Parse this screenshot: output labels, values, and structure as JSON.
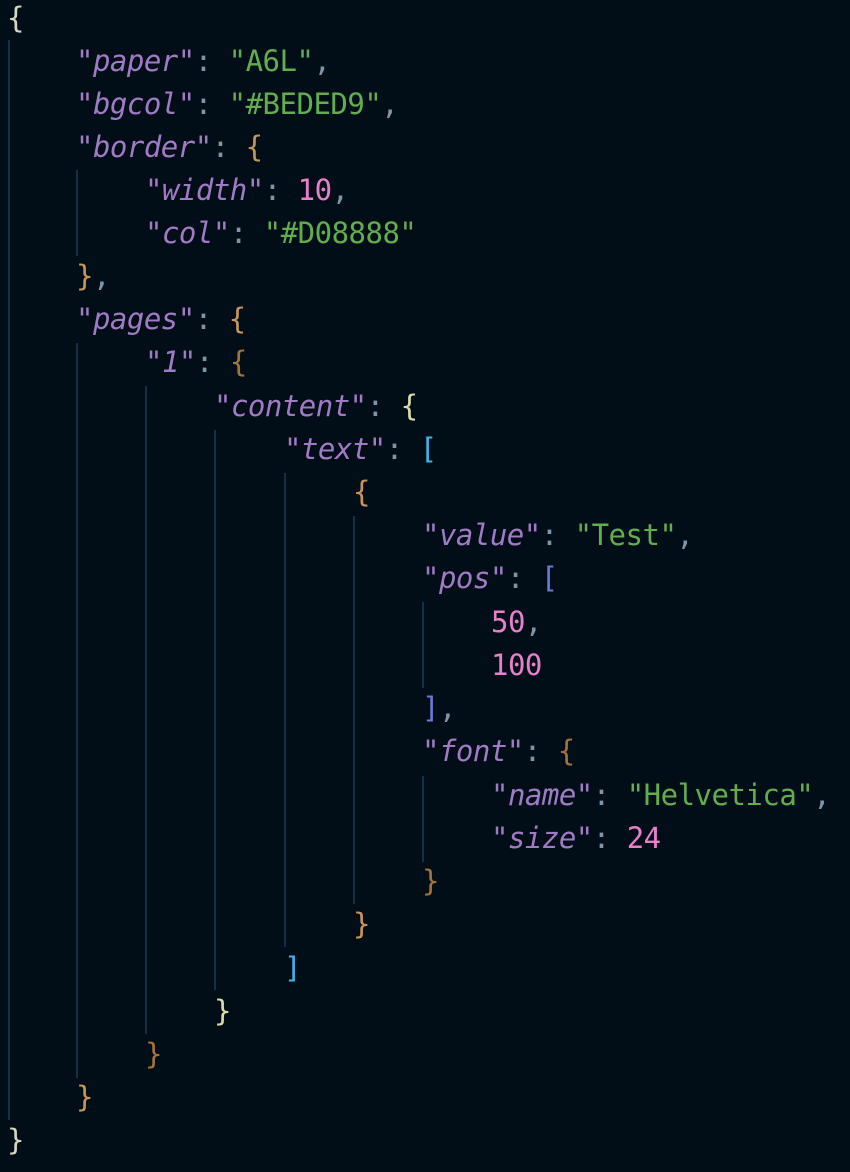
{
  "editor": {
    "language": "json",
    "colors": {
      "background": "#010e18",
      "key": "#a07bc4",
      "string": "#62ad4f",
      "number": "#e77fc9",
      "indent_guide": "#13304a"
    },
    "lines": [
      "{",
      "\"paper\": \"A6L\",",
      "\"bgcol\": \"#BEDED9\",",
      "\"border\": {",
      "\"width\": 10,",
      "\"col\": \"#D08888\"",
      "},",
      "\"pages\": {",
      "\"1\": {",
      "\"content\": {",
      "\"text\": [",
      "{",
      "\"value\": \"Test\",",
      "\"pos\": [",
      "50,",
      "100",
      "],",
      "\"font\": {",
      "\"name\": \"Helvetica\",",
      "\"size\": 24",
      "}",
      "}",
      "]",
      "}",
      "}",
      "}",
      "}"
    ],
    "tokens": {
      "open_root": "{",
      "close_root": "}",
      "k_paper": "\"paper\"",
      "v_paper": "\"A6L\"",
      "k_bgcol": "\"bgcol\"",
      "v_bgcol": "\"#BEDED9\"",
      "k_border": "\"border\"",
      "k_width": "\"width\"",
      "v_width": "10",
      "k_col": "\"col\"",
      "v_col": "\"#D08888\"",
      "k_pages": "\"pages\"",
      "k_page1": "\"1\"",
      "k_content": "\"content\"",
      "k_text": "\"text\"",
      "k_value": "\"value\"",
      "v_value": "\"Test\"",
      "k_pos": "\"pos\"",
      "v_pos_x": "50",
      "v_pos_y": "100",
      "k_font": "\"font\"",
      "k_name": "\"name\"",
      "v_name": "\"Helvetica\"",
      "k_size": "\"size\"",
      "v_size": "24",
      "colon": ": ",
      "comma": ",",
      "brace_open": "{",
      "brace_close": "}",
      "bracket_open": "[",
      "bracket_close": "]"
    }
  }
}
